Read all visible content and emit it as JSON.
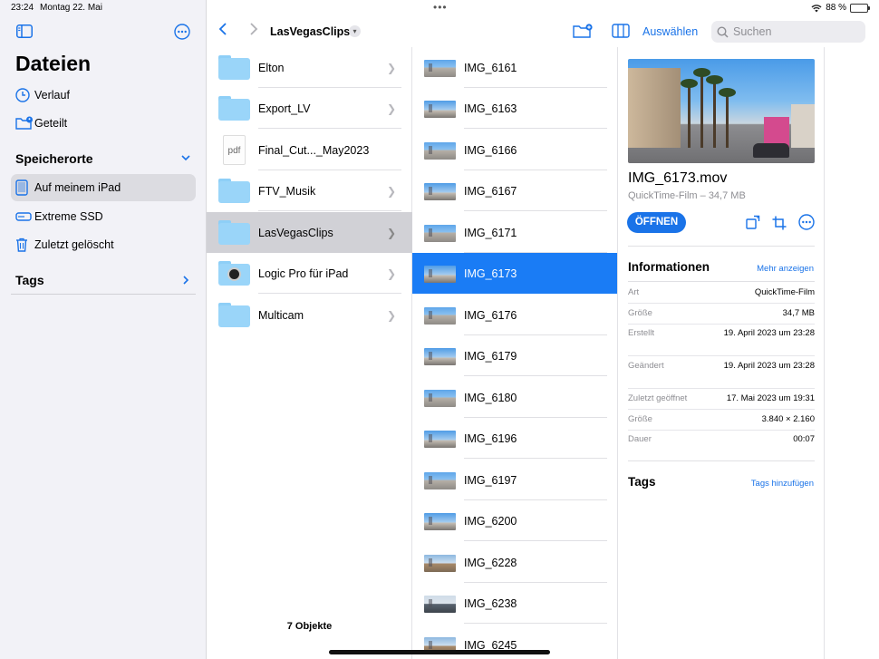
{
  "status": {
    "time": "23:24",
    "date": "Montag 22. Mai",
    "battery": "88 %",
    "battery_level": 0.88
  },
  "sidebar": {
    "title": "Dateien",
    "top_items": [
      {
        "label": "Verlauf",
        "icon": "clock-icon"
      },
      {
        "label": "Geteilt",
        "icon": "shared-folder-icon"
      }
    ],
    "locations_header": "Speicherorte",
    "locations": [
      {
        "label": "Auf meinem iPad",
        "icon": "ipad-icon",
        "selected": true
      },
      {
        "label": "Extreme SSD",
        "icon": "drive-icon"
      },
      {
        "label": "Zuletzt gelöscht",
        "icon": "trash-icon"
      }
    ],
    "tags_header": "Tags"
  },
  "toolbar": {
    "title": "LasVegasClips",
    "select_label": "Auswählen",
    "search_placeholder": "Suchen"
  },
  "folder_column": {
    "items": [
      {
        "label": "Elton",
        "type": "folder"
      },
      {
        "label": "Export_LV",
        "type": "folder"
      },
      {
        "label": "Final_Cut..._May2023",
        "type": "pdf",
        "type_label": "pdf"
      },
      {
        "label": "FTV_Musik",
        "type": "folder"
      },
      {
        "label": "LasVegasClips",
        "type": "folder",
        "selected": true
      },
      {
        "label": "Logic Pro für iPad",
        "type": "app-folder"
      },
      {
        "label": "Multicam",
        "type": "folder"
      }
    ],
    "count_label": "7 Objekte"
  },
  "file_column": {
    "items": [
      "IMG_6161",
      "IMG_6163",
      "IMG_6166",
      "IMG_6167",
      "IMG_6171",
      "IMG_6173",
      "IMG_6176",
      "IMG_6179",
      "IMG_6180",
      "IMG_6196",
      "IMG_6197",
      "IMG_6200",
      "IMG_6228",
      "IMG_6238",
      "IMG_6245"
    ],
    "selected": "IMG_6173"
  },
  "preview": {
    "file_name": "IMG_6173.mov",
    "subtitle": "QuickTime-Film – 34,7 MB",
    "open_label": "ÖFFNEN",
    "info_header": "Informationen",
    "more_label": "Mehr anzeigen",
    "info": [
      {
        "key": "Art",
        "value": "QuickTime-Film"
      },
      {
        "key": "Größe",
        "value": "34,7 MB"
      },
      {
        "key": "Erstellt",
        "value": "19. April 2023 um 23:28"
      },
      {
        "key": "Geändert",
        "value": "19. April 2023 um 23:28"
      },
      {
        "key": "Zuletzt geöffnet",
        "value": "17. Mai 2023 um 19:31"
      },
      {
        "key": "Größe",
        "value": "3.840 × 2.160"
      },
      {
        "key": "Dauer",
        "value": "00:07"
      }
    ],
    "tags_header": "Tags",
    "add_tags_label": "Tags hinzufügen"
  },
  "colors": {
    "accent": "#1a73e8",
    "selection_blue": "#1a7cf5",
    "sidebar_bg": "#f2f2f7"
  }
}
